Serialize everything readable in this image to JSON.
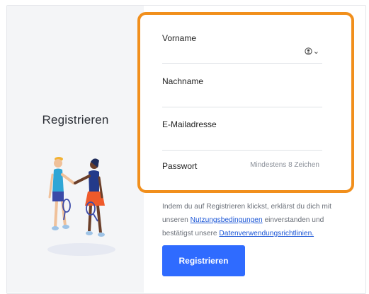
{
  "left": {
    "title": "Registrieren"
  },
  "form": {
    "first_name_label": "Vorname",
    "last_name_label": "Nachname",
    "email_label": "E-Mailadresse",
    "password_label": "Passwort",
    "password_hint": "Mindestens 8 Zeichen",
    "autofill_icon": "contact-card-icon"
  },
  "terms": {
    "prefix": "Indem du auf Registrieren klickst, erklärst du dich mit unseren ",
    "link1": "Nutzungsbedingungen",
    "middle": " einverstanden und bestätigst unsere ",
    "link2": "Datenverwendungsrichtlinien."
  },
  "submit_label": "Registrieren",
  "colors": {
    "highlight": "#f18f1c",
    "button": "#2f6bff",
    "link": "#1a55d6"
  }
}
